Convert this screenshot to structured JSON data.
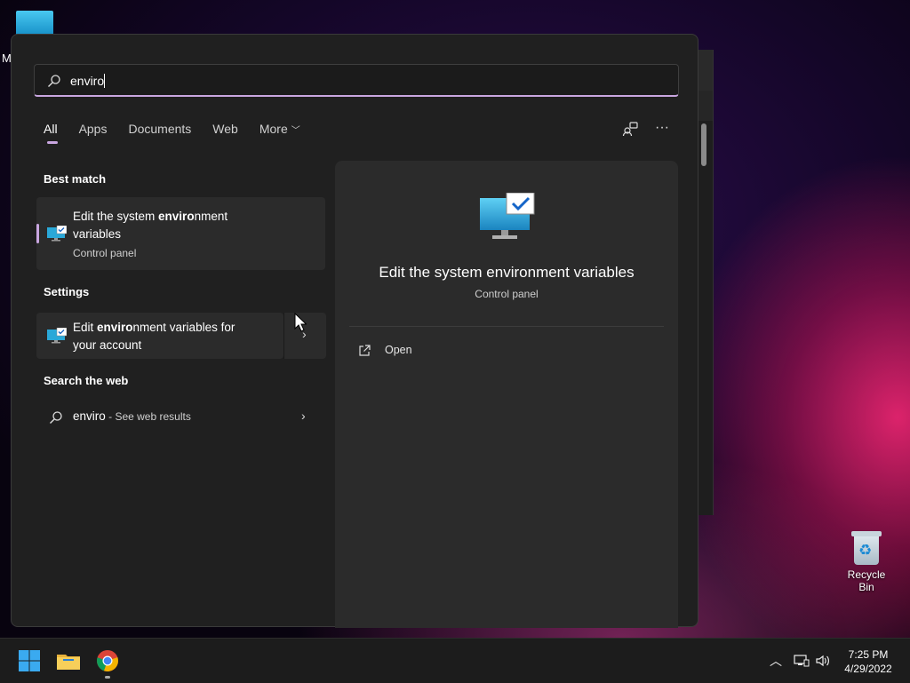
{
  "desktop": {
    "partial_label": "M",
    "recycle_bin_label": "Recycle Bin"
  },
  "search": {
    "query": "enviro"
  },
  "tabs": [
    {
      "label": "All",
      "active": true
    },
    {
      "label": "Apps",
      "active": false
    },
    {
      "label": "Documents",
      "active": false
    },
    {
      "label": "Web",
      "active": false
    },
    {
      "label": "More",
      "active": false
    }
  ],
  "sections": {
    "best_match": "Best match",
    "settings": "Settings",
    "search_web": "Search the web"
  },
  "best_match": {
    "title_prefix": "Edit the system ",
    "title_bold": "enviro",
    "title_suffix": "nment",
    "title_line2": "variables",
    "subtitle": "Control panel",
    "icon": "monitor-check-icon"
  },
  "settings_result": {
    "title_prefix": "Edit ",
    "title_bold": "enviro",
    "title_suffix": "nment variables for",
    "title_line2": "your account",
    "icon": "monitor-check-icon"
  },
  "web_result": {
    "query": "enviro",
    "suffix": " - See web results"
  },
  "preview": {
    "title": "Edit the system environment variables",
    "subtitle": "Control panel",
    "action_open": "Open"
  },
  "taskbar": {
    "time": "7:25 PM",
    "date": "4/29/2022"
  },
  "colors": {
    "accent": "#c9a6e0",
    "panel_bg": "#202020",
    "card_bg": "#2b2b2b",
    "taskbar_bg": "#1c1c1c"
  }
}
